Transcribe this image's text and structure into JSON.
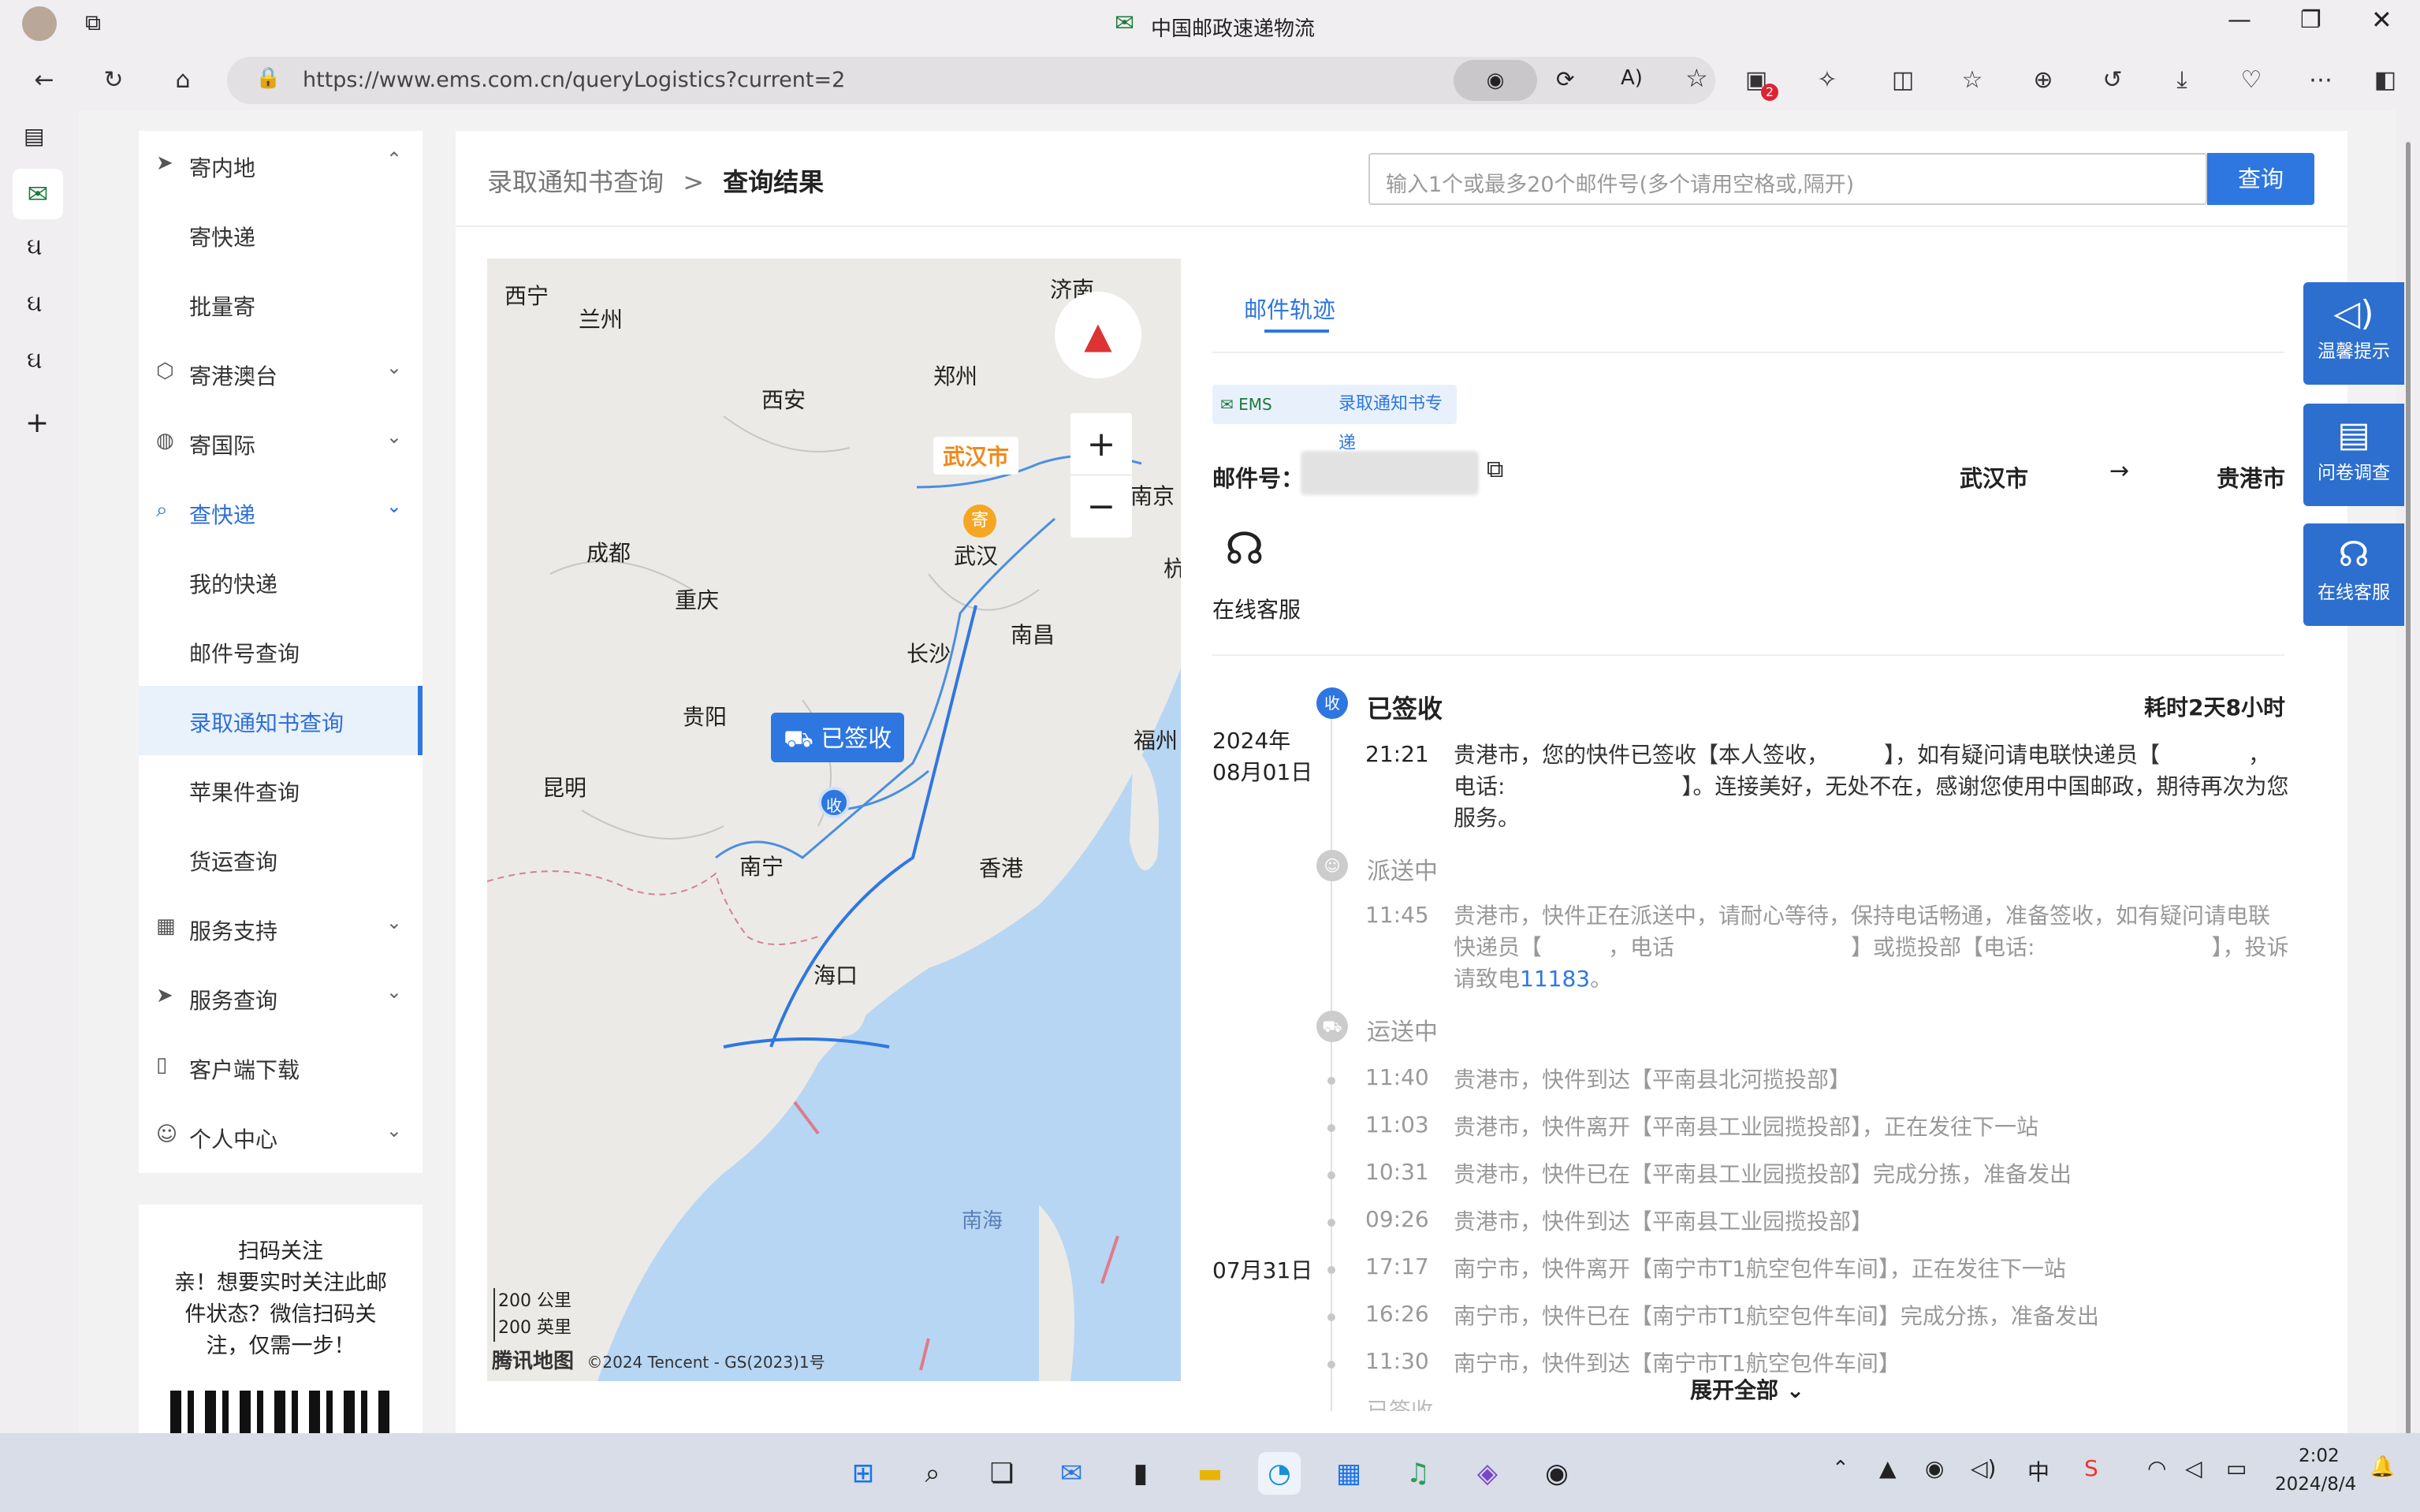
{
  "browser": {
    "title": "中国邮政速递物流",
    "url": "https://www.ems.com.cn/queryLogistics?current=2",
    "notif_count": "2"
  },
  "menu": {
    "items": [
      {
        "label": "寄内地",
        "icon": "send-icon",
        "chev": "⌃"
      },
      {
        "label": "寄快递"
      },
      {
        "label": "批量寄"
      },
      {
        "label": "寄港澳台",
        "icon": "cube-icon",
        "chev": "⌄"
      },
      {
        "label": "寄国际",
        "icon": "globe-icon",
        "chev": "⌄"
      },
      {
        "label": "查快递",
        "icon": "search-icon",
        "chev": "⌄"
      },
      {
        "label": "我的快递"
      },
      {
        "label": "邮件号查询"
      },
      {
        "label": "录取通知书查询"
      },
      {
        "label": "苹果件查询"
      },
      {
        "label": "货运查询"
      },
      {
        "label": "服务支持",
        "icon": "calendar-icon",
        "chev": "⌄"
      },
      {
        "label": "服务查询",
        "icon": "send-icon",
        "chev": "⌄"
      },
      {
        "label": "客户端下载",
        "icon": "phone-icon"
      },
      {
        "label": "个人中心",
        "icon": "user-icon",
        "chev": "⌄"
      }
    ]
  },
  "qr": {
    "line1": "扫码关注",
    "line2": "亲！想要实时关注此邮",
    "line3": "件状态？微信扫码关",
    "line4": "注，仅需一步！"
  },
  "breadcrumb": {
    "parent": "录取通知书查询",
    "sep": ">",
    "current": "查询结果"
  },
  "search": {
    "placeholder": "输入1个或最多20个邮件号(多个请用空格或,隔开)",
    "button": "查询"
  },
  "map": {
    "cities": [
      "西宁",
      "兰州",
      "济南",
      "西安",
      "郑州",
      "成都",
      "重庆",
      "武汉",
      "南京",
      "杭",
      "长沙",
      "南昌",
      "贵阳",
      "福州",
      "昆明",
      "南宁",
      "香港",
      "海口",
      "南海"
    ],
    "origin_label": "武汉市",
    "origin_pin": "寄",
    "delivered_bubble": "已签收",
    "delivered_pin": "收",
    "scale1": "200 公里",
    "scale2": "200 英里",
    "brand": "腾讯地图",
    "copyright": "©2024 Tencent - GS(2023)1号",
    "zoom_in": "+",
    "zoom_out": "−"
  },
  "tracking": {
    "tab": "邮件轨迹",
    "logo_text": "录取通知书专递",
    "mail_no_label": "邮件号：",
    "from": "武汉市",
    "arrow": "→",
    "to": "贵港市",
    "service_label": "在线客服",
    "status_signed": "已签收",
    "duration": "耗时2天8小时",
    "date1_year": "2024年",
    "date1_day": "08月01日",
    "time1": "21:21",
    "text1": "贵港市，您的快件已签收【本人签收，　　　】，如有疑问请电联快递员【　　　　，电话:　　　　　　　　】。连接美好，无处不在，感谢您使用中国邮政，期待再次为您服务。",
    "status_delivering": "派送中",
    "time2": "11:45",
    "text2": "贵港市，快件正在派送中，请耐心等待，保持电话畅通，准备签收，如有疑问请电联快递员【　　　，电话　　　　　　　　】或揽投部【电话:　　　　　　　　】，投诉请致电",
    "hotline": "11183",
    "text2_end": "。",
    "status_transit": "运送中",
    "events": [
      {
        "time": "11:40",
        "text": "贵港市，快件到达【平南县北河揽投部】"
      },
      {
        "time": "11:03",
        "text": "贵港市，快件离开【平南县工业园揽投部】，正在发往下一站"
      },
      {
        "time": "10:31",
        "text": "贵港市，快件已在【平南县工业园揽投部】完成分拣，准备发出"
      },
      {
        "time": "09:26",
        "text": "贵港市，快件到达【平南县工业园揽投部】"
      },
      {
        "time": "17:17",
        "text": "南宁市，快件离开【南宁市T1航空包件车间】，正在发往下一站"
      },
      {
        "time": "16:26",
        "text": "南宁市，快件已在【南宁市T1航空包件车间】完成分拣，准备发出"
      },
      {
        "time": "11:30",
        "text": "南宁市，快件到达【南宁市T1航空包件车间】"
      }
    ],
    "date2": "07月31日",
    "last_status": "已签收",
    "expand": "展开全部"
  },
  "side_buttons": [
    {
      "label": "温馨提示",
      "icon": "speaker-icon"
    },
    {
      "label": "问卷调查",
      "icon": "clipboard-icon"
    },
    {
      "label": "在线客服",
      "icon": "headset-icon"
    }
  ],
  "taskbar": {
    "ime": "中",
    "time": "2:02",
    "date": "2024/8/4"
  }
}
